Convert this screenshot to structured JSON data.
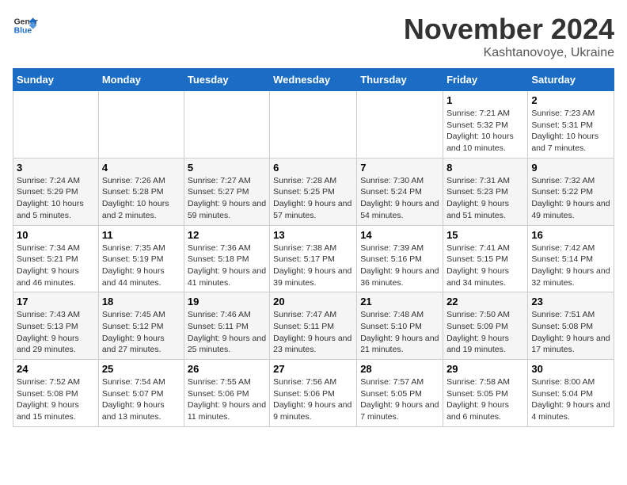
{
  "header": {
    "logo_line1": "General",
    "logo_line2": "Blue",
    "month": "November 2024",
    "location": "Kashtanovoye, Ukraine"
  },
  "weekdays": [
    "Sunday",
    "Monday",
    "Tuesday",
    "Wednesday",
    "Thursday",
    "Friday",
    "Saturday"
  ],
  "weeks": [
    [
      {
        "day": "",
        "info": ""
      },
      {
        "day": "",
        "info": ""
      },
      {
        "day": "",
        "info": ""
      },
      {
        "day": "",
        "info": ""
      },
      {
        "day": "",
        "info": ""
      },
      {
        "day": "1",
        "info": "Sunrise: 7:21 AM\nSunset: 5:32 PM\nDaylight: 10 hours and 10 minutes."
      },
      {
        "day": "2",
        "info": "Sunrise: 7:23 AM\nSunset: 5:31 PM\nDaylight: 10 hours and 7 minutes."
      }
    ],
    [
      {
        "day": "3",
        "info": "Sunrise: 7:24 AM\nSunset: 5:29 PM\nDaylight: 10 hours and 5 minutes."
      },
      {
        "day": "4",
        "info": "Sunrise: 7:26 AM\nSunset: 5:28 PM\nDaylight: 10 hours and 2 minutes."
      },
      {
        "day": "5",
        "info": "Sunrise: 7:27 AM\nSunset: 5:27 PM\nDaylight: 9 hours and 59 minutes."
      },
      {
        "day": "6",
        "info": "Sunrise: 7:28 AM\nSunset: 5:25 PM\nDaylight: 9 hours and 57 minutes."
      },
      {
        "day": "7",
        "info": "Sunrise: 7:30 AM\nSunset: 5:24 PM\nDaylight: 9 hours and 54 minutes."
      },
      {
        "day": "8",
        "info": "Sunrise: 7:31 AM\nSunset: 5:23 PM\nDaylight: 9 hours and 51 minutes."
      },
      {
        "day": "9",
        "info": "Sunrise: 7:32 AM\nSunset: 5:22 PM\nDaylight: 9 hours and 49 minutes."
      }
    ],
    [
      {
        "day": "10",
        "info": "Sunrise: 7:34 AM\nSunset: 5:21 PM\nDaylight: 9 hours and 46 minutes."
      },
      {
        "day": "11",
        "info": "Sunrise: 7:35 AM\nSunset: 5:19 PM\nDaylight: 9 hours and 44 minutes."
      },
      {
        "day": "12",
        "info": "Sunrise: 7:36 AM\nSunset: 5:18 PM\nDaylight: 9 hours and 41 minutes."
      },
      {
        "day": "13",
        "info": "Sunrise: 7:38 AM\nSunset: 5:17 PM\nDaylight: 9 hours and 39 minutes."
      },
      {
        "day": "14",
        "info": "Sunrise: 7:39 AM\nSunset: 5:16 PM\nDaylight: 9 hours and 36 minutes."
      },
      {
        "day": "15",
        "info": "Sunrise: 7:41 AM\nSunset: 5:15 PM\nDaylight: 9 hours and 34 minutes."
      },
      {
        "day": "16",
        "info": "Sunrise: 7:42 AM\nSunset: 5:14 PM\nDaylight: 9 hours and 32 minutes."
      }
    ],
    [
      {
        "day": "17",
        "info": "Sunrise: 7:43 AM\nSunset: 5:13 PM\nDaylight: 9 hours and 29 minutes."
      },
      {
        "day": "18",
        "info": "Sunrise: 7:45 AM\nSunset: 5:12 PM\nDaylight: 9 hours and 27 minutes."
      },
      {
        "day": "19",
        "info": "Sunrise: 7:46 AM\nSunset: 5:11 PM\nDaylight: 9 hours and 25 minutes."
      },
      {
        "day": "20",
        "info": "Sunrise: 7:47 AM\nSunset: 5:11 PM\nDaylight: 9 hours and 23 minutes."
      },
      {
        "day": "21",
        "info": "Sunrise: 7:48 AM\nSunset: 5:10 PM\nDaylight: 9 hours and 21 minutes."
      },
      {
        "day": "22",
        "info": "Sunrise: 7:50 AM\nSunset: 5:09 PM\nDaylight: 9 hours and 19 minutes."
      },
      {
        "day": "23",
        "info": "Sunrise: 7:51 AM\nSunset: 5:08 PM\nDaylight: 9 hours and 17 minutes."
      }
    ],
    [
      {
        "day": "24",
        "info": "Sunrise: 7:52 AM\nSunset: 5:08 PM\nDaylight: 9 hours and 15 minutes."
      },
      {
        "day": "25",
        "info": "Sunrise: 7:54 AM\nSunset: 5:07 PM\nDaylight: 9 hours and 13 minutes."
      },
      {
        "day": "26",
        "info": "Sunrise: 7:55 AM\nSunset: 5:06 PM\nDaylight: 9 hours and 11 minutes."
      },
      {
        "day": "27",
        "info": "Sunrise: 7:56 AM\nSunset: 5:06 PM\nDaylight: 9 hours and 9 minutes."
      },
      {
        "day": "28",
        "info": "Sunrise: 7:57 AM\nSunset: 5:05 PM\nDaylight: 9 hours and 7 minutes."
      },
      {
        "day": "29",
        "info": "Sunrise: 7:58 AM\nSunset: 5:05 PM\nDaylight: 9 hours and 6 minutes."
      },
      {
        "day": "30",
        "info": "Sunrise: 8:00 AM\nSunset: 5:04 PM\nDaylight: 9 hours and 4 minutes."
      }
    ]
  ]
}
